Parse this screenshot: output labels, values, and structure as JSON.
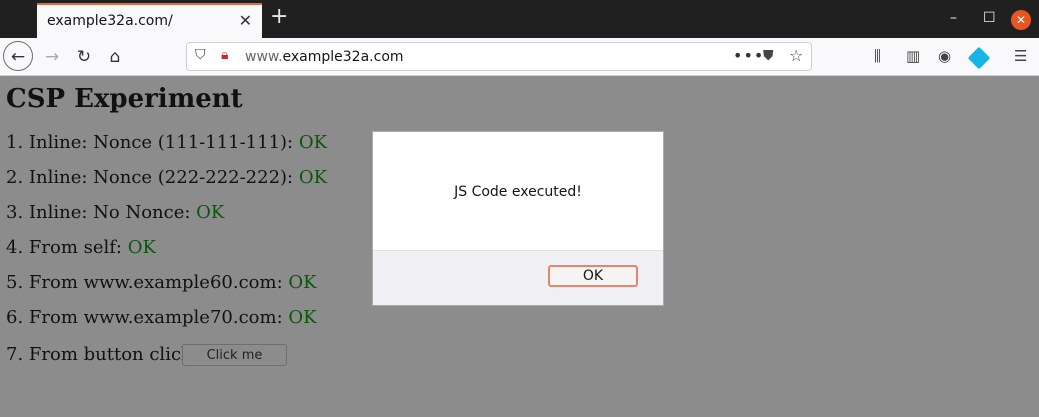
{
  "browser": {
    "tab_title": "example32a.com/",
    "url_domain_prefix": "www.",
    "url_domain": "example32a.com",
    "icons": [
      "close-icon",
      "plus-icon",
      "back-arrow-icon",
      "forward-arrow-icon",
      "reload-icon",
      "home-icon",
      "shield-icon",
      "insecure-lock-icon",
      "more-icon",
      "pocket-icon",
      "star-icon",
      "library-icon",
      "sidebar-icon",
      "account-icon",
      "extension-icon",
      "menu-icon"
    ]
  },
  "page": {
    "title": "CSP Experiment",
    "items": [
      {
        "label": "1. Inline: Nonce (111-111-111): ",
        "status": "OK"
      },
      {
        "label": "2. Inline: Nonce (222-222-222): ",
        "status": "OK"
      },
      {
        "label": "3. Inline: No Nonce: ",
        "status": "OK"
      },
      {
        "label": "4. From self: ",
        "status": "OK"
      },
      {
        "label": "5. From www.example60.com: ",
        "status": "OK"
      },
      {
        "label": "6. From www.example70.com: ",
        "status": "OK"
      }
    ],
    "button_item_label": "7. From button click:",
    "button_label": "Click me"
  },
  "dialog": {
    "message": "JS Code executed!",
    "ok_label": "OK"
  },
  "colors": {
    "ok_green": "#0c550c",
    "overlay_gray": "#8c8c8c",
    "tab_accent": "#e66b3c"
  }
}
